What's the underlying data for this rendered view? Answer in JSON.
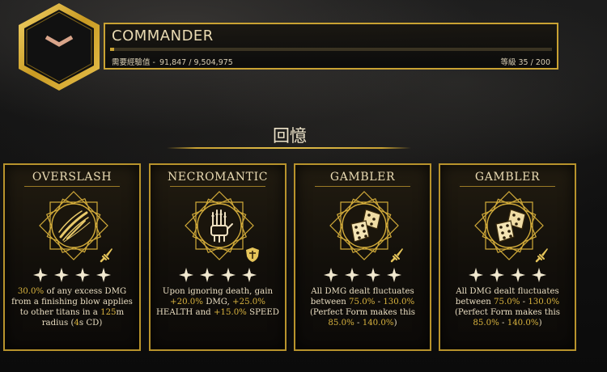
{
  "header": {
    "title": "COMMANDER",
    "xp_label": "需要經驗值 -",
    "xp_current": "91,847",
    "xp_sep": " / ",
    "xp_total": "9,504,975",
    "level_label": "等級",
    "level_current": "35",
    "level_sep": " / ",
    "level_max": "200",
    "xp_progress": 0.0097
  },
  "section": {
    "title": "回憶"
  },
  "cards": [
    {
      "title": "OVERSLASH",
      "stars": 4,
      "icon": "blade-slash-icon",
      "badge": "sword-badge-icon",
      "desc": [
        {
          "t": "30.0%",
          "g": true
        },
        {
          "t": " of any excess DMG from a finishing blow applies to other titans in a "
        },
        {
          "t": "125",
          "g": true
        },
        {
          "t": "m radius ("
        },
        {
          "t": "4",
          "g": true
        },
        {
          "t": "s CD)"
        }
      ]
    },
    {
      "title": "NECROMANTIC",
      "stars": 4,
      "icon": "skeletal-hand-icon",
      "badge": "shield-badge-icon",
      "desc": [
        {
          "t": "Upon ignoring death, gain "
        },
        {
          "t": "+20.0%",
          "g": true
        },
        {
          "t": " DMG, "
        },
        {
          "t": "+25.0%",
          "g": true
        },
        {
          "t": " HEALTH and "
        },
        {
          "t": "+15.0%",
          "g": true
        },
        {
          "t": " SPEED"
        }
      ]
    },
    {
      "title": "GAMBLER",
      "stars": 4,
      "icon": "dice-icon",
      "badge": "sword-badge-icon",
      "desc": [
        {
          "t": "All DMG dealt fluctuates between "
        },
        {
          "t": "75.0%",
          "g": true
        },
        {
          "t": " - "
        },
        {
          "t": "130.0%",
          "g": true
        },
        {
          "t": " (Perfect Form makes this "
        },
        {
          "t": "85.0%",
          "g": true
        },
        {
          "t": " - "
        },
        {
          "t": "140.0%",
          "g": true
        },
        {
          "t": ")"
        }
      ]
    },
    {
      "title": "GAMBLER",
      "stars": 4,
      "icon": "dice-icon",
      "badge": "sword-badge-icon",
      "desc": [
        {
          "t": "All DMG dealt fluctuates between "
        },
        {
          "t": "75.0%",
          "g": true
        },
        {
          "t": " - "
        },
        {
          "t": "130.0%",
          "g": true
        },
        {
          "t": " (Perfect Form makes this "
        },
        {
          "t": "85.0%",
          "g": true
        },
        {
          "t": " - "
        },
        {
          "t": "140.0%",
          "g": true
        },
        {
          "t": ")"
        }
      ]
    }
  ],
  "colors": {
    "accent": "#c9a233",
    "highlight": "#d8b23e",
    "text": "#e8dcc0"
  }
}
